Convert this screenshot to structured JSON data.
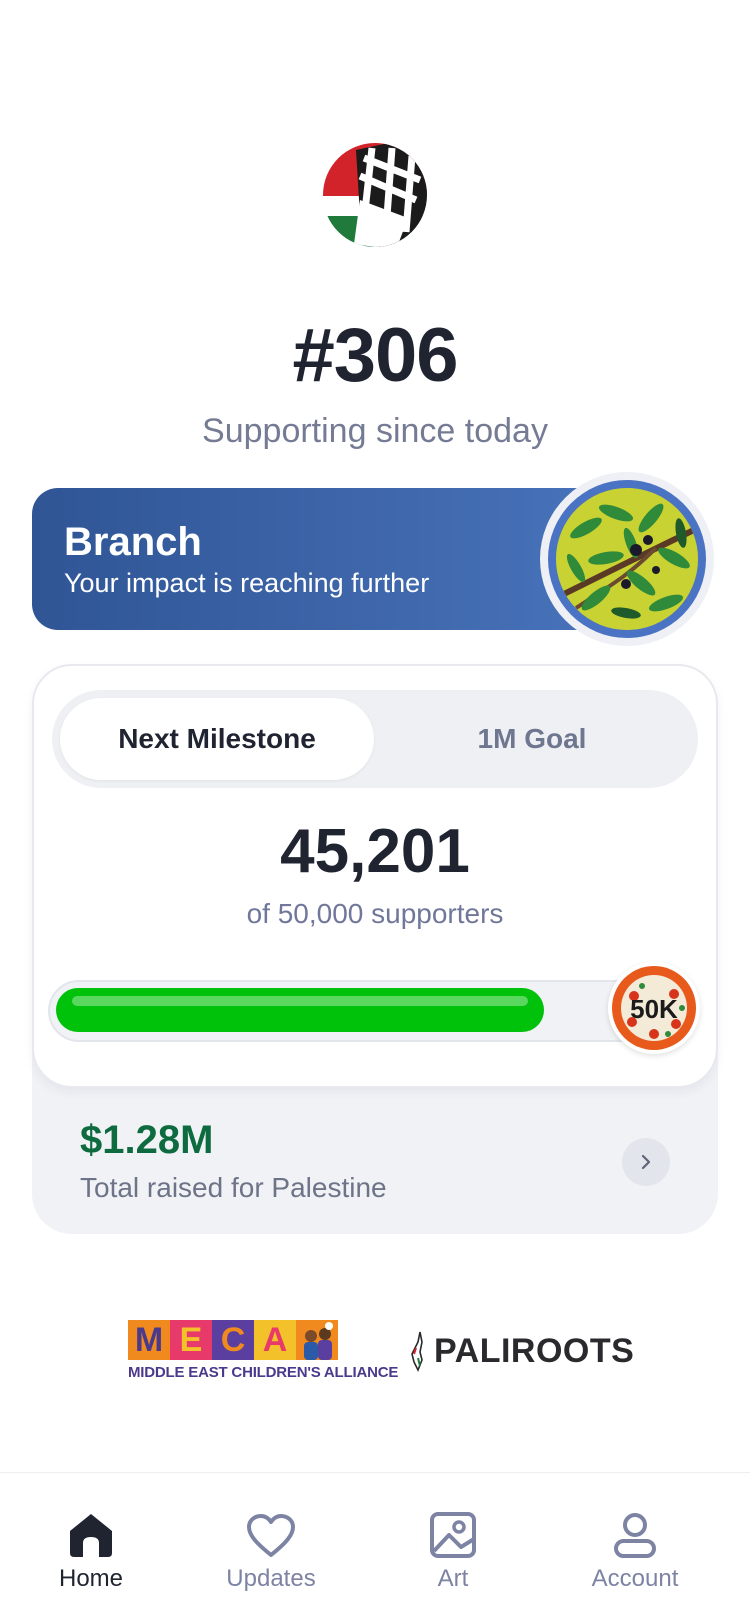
{
  "member": {
    "number": "#306",
    "since": "Supporting since today"
  },
  "tier": {
    "name": "Branch",
    "description": "Your impact is reaching further"
  },
  "milestone": {
    "tabs": [
      "Next Milestone",
      "1M Goal"
    ],
    "active_tab": "Next Milestone",
    "current_count": "45,201",
    "target_text": "of 50,000 supporters",
    "progress_fraction": 0.904,
    "badge_label": "50K"
  },
  "raised": {
    "amount": "$1.28M",
    "label": "Total raised for Palestine"
  },
  "partners": {
    "meca": {
      "letters": [
        "M",
        "E",
        "C",
        "A"
      ],
      "subtitle": "MIDDLE EAST CHILDREN'S ALLIANCE"
    },
    "paliroots": "PALIROOTS"
  },
  "nav": {
    "items": [
      {
        "label": "Home",
        "icon": "home-icon",
        "active": true
      },
      {
        "label": "Updates",
        "icon": "heart-icon",
        "active": false
      },
      {
        "label": "Art",
        "icon": "image-icon",
        "active": false
      },
      {
        "label": "Account",
        "icon": "user-icon",
        "active": false
      }
    ]
  },
  "colors": {
    "tier_blue": "#3f67ab",
    "progress_green": "#00c20a",
    "raised_green": "#0e6a3f",
    "text_dark": "#1f2430",
    "text_muted": "#757b94"
  }
}
